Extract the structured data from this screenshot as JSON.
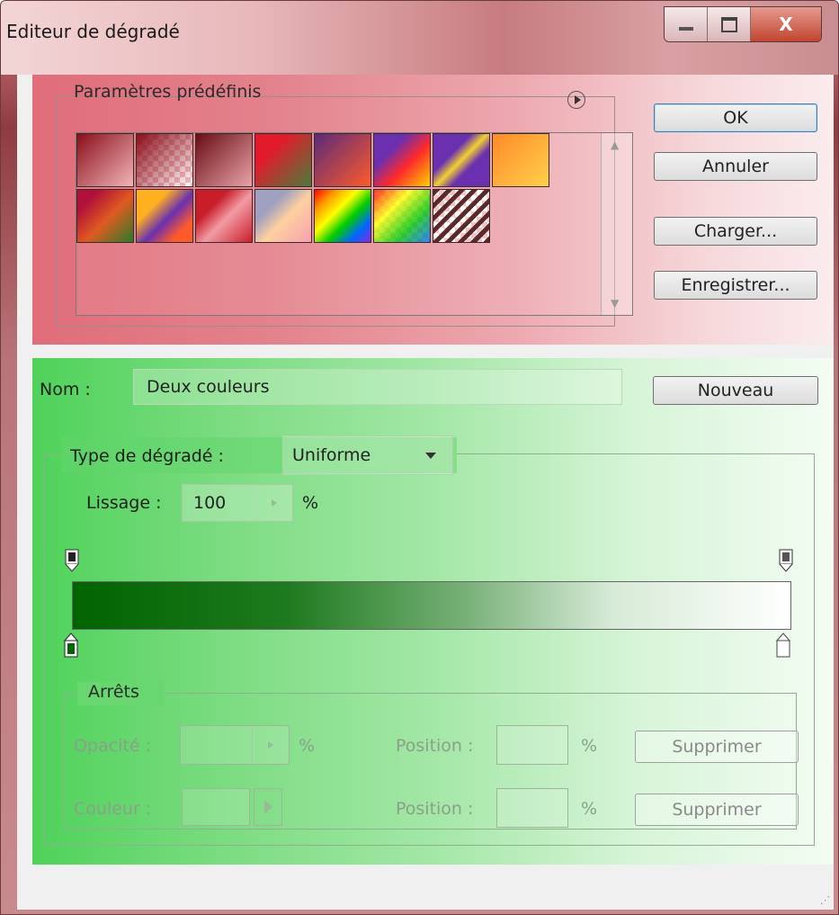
{
  "window": {
    "title": "Editeur de dégradé",
    "min_icon": "minimize-icon",
    "max_icon": "maximize-icon",
    "close_label": "X"
  },
  "presets": {
    "legend": "Paramètres prédéfinis",
    "menu_icon": "play-circle-icon",
    "scroll_up_icon": "triangle-up-icon",
    "scroll_down_icon": "triangle-down-icon",
    "rows": [
      [
        "#8a0e1a-#f2b5b8",
        "#8a0e1a-transparent",
        "#6a0c14-#e8a3a9",
        "#e21b2c-#4a7b3a",
        "#5a2a7a-#ff5a2a",
        "#6a30b0-#ff2a2a",
        "#6a30b0-#f2d030",
        "#ff8a2a-#ffd04a"
      ],
      [
        "#b0103a-#2a7a2a",
        "#ffb020-#6a30b0",
        "#c81e2a-#f29ba4",
        "#a0a0c0-#ffd0a0",
        "rainbow",
        "rainbow-transparent",
        "stripes-transparent"
      ]
    ]
  },
  "buttons": {
    "ok": "OK",
    "cancel": "Annuler",
    "load": "Charger...",
    "save": "Enregistrer...",
    "new": "Nouveau"
  },
  "name": {
    "label": "Nom :",
    "value": "Deux couleurs"
  },
  "gradient": {
    "type_label": "Type de dégradé :",
    "type_value": "Uniforme",
    "smooth_label": "Lissage :",
    "smooth_value": "100",
    "smooth_unit": "%",
    "colors": {
      "start": "#006400",
      "end": "#ffffff"
    }
  },
  "stops": {
    "legend": "Arrêts",
    "opacity_label": "Opacité :",
    "opacity_value": "",
    "opacity_unit": "%",
    "opacity_position_label": "Position :",
    "opacity_position_value": "",
    "opacity_position_unit": "%",
    "opacity_delete": "Supprimer",
    "color_label": "Couleur :",
    "color_position_label": "Position :",
    "color_position_value": "",
    "color_position_unit": "%",
    "color_delete": "Supprimer"
  }
}
